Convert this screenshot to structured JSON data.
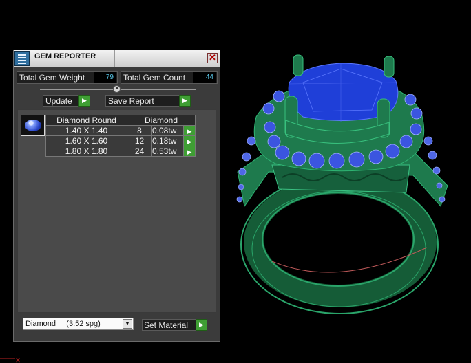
{
  "panel": {
    "title": "GEM REPORTER",
    "close_glyph": "✕",
    "icon": "app-icon",
    "totals": {
      "weight_label": "Total Gem Weight",
      "weight_value": ".79",
      "count_label": "Total Gem Count",
      "count_value": "44"
    },
    "buttons": {
      "update_label": "Update",
      "save_report_label": "Save Report",
      "go_glyph": "▶"
    },
    "table": {
      "headers": [
        "Diamond Round",
        "Diamond"
      ],
      "rows": [
        {
          "size": "1.40 X 1.40",
          "count": "8",
          "weight": "0.08tw"
        },
        {
          "size": "1.60 X 1.60",
          "count": "12",
          "weight": "0.18tw"
        },
        {
          "size": "1.80 X 1.80",
          "count": "24",
          "weight": "0.53tw"
        }
      ]
    },
    "material": {
      "selected": "Diamond     (3.52 spg)",
      "dropdown_glyph": "▼",
      "set_label": "Set Material"
    }
  },
  "colors": {
    "ring_green": "#1e7a4d",
    "gem_blue": "#1f3fd8",
    "accent_value": "#58c7e8",
    "go_green": "#3f9e34"
  }
}
